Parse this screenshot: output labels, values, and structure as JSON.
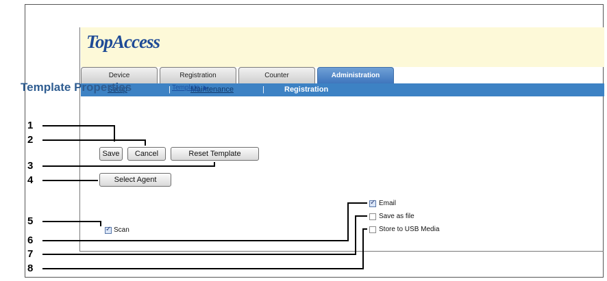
{
  "app": {
    "logo": "TopAccess",
    "tabs": [
      {
        "label": "Device",
        "active": false
      },
      {
        "label": "Registration",
        "active": false
      },
      {
        "label": "Counter",
        "active": false
      },
      {
        "label": "Administration",
        "active": true
      }
    ],
    "subnav": {
      "items": [
        {
          "label": "Setup",
          "current": false
        },
        {
          "label": "Maintenance",
          "current": false
        },
        {
          "label": "Registration",
          "current": true
        }
      ],
      "separator": "|"
    }
  },
  "page": {
    "title": "Template Properties",
    "template_link": "Template"
  },
  "buttons": {
    "save": "Save",
    "cancel": "Cancel",
    "reset_template": "Reset Template",
    "select_agent": "Select Agent"
  },
  "checkboxes": [
    {
      "label": "Scan",
      "checked": true
    },
    {
      "label": "Email",
      "checked": true
    },
    {
      "label": "Save as file",
      "checked": false
    },
    {
      "label": "Store to USB Media",
      "checked": false
    }
  ],
  "callouts": [
    "1",
    "2",
    "3",
    "4",
    "5",
    "6",
    "7",
    "8"
  ],
  "colors": {
    "accent_blue": "#3d82c4",
    "header_bg": "#fdf9d8",
    "title_blue": "#2f5d91"
  }
}
